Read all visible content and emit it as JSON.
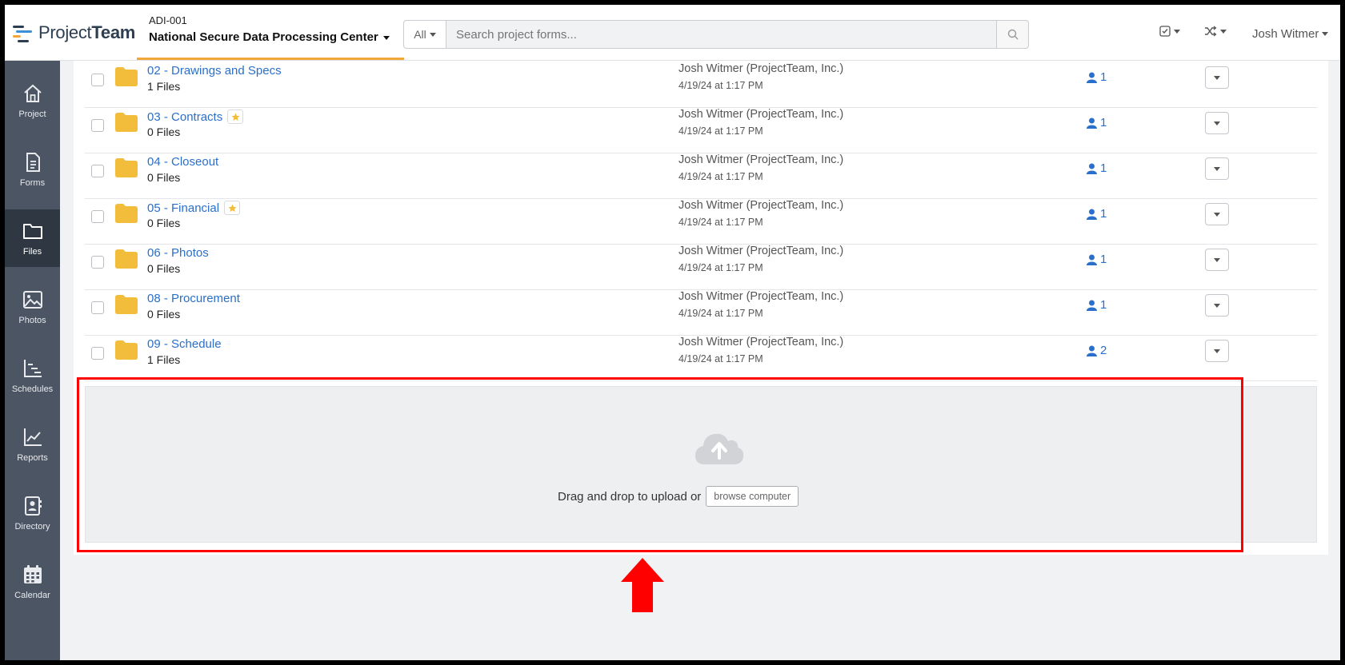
{
  "header": {
    "logo_prefix": "Project",
    "logo_suffix": "Team",
    "project_code": "ADI-001",
    "project_name": "National Secure Data Processing Center",
    "search_scope": "All",
    "search_placeholder": "Search project forms...",
    "user_name": "Josh Witmer",
    "icons": [
      "checklist-icon",
      "shuffle-icon",
      "search-icon"
    ]
  },
  "sidebar": {
    "items": [
      {
        "label": "Project",
        "icon": "home-icon",
        "active": false
      },
      {
        "label": "Forms",
        "icon": "document-icon",
        "active": false
      },
      {
        "label": "Files",
        "icon": "folder-icon",
        "active": true
      },
      {
        "label": "Photos",
        "icon": "image-icon",
        "active": false
      },
      {
        "label": "Schedules",
        "icon": "gantt-icon",
        "active": false
      },
      {
        "label": "Reports",
        "icon": "chart-icon",
        "active": false
      },
      {
        "label": "Directory",
        "icon": "contact-card-icon",
        "active": false
      },
      {
        "label": "Calendar",
        "icon": "calendar-icon",
        "active": false
      }
    ]
  },
  "folders": [
    {
      "name": "02 - Drawings and Specs",
      "count": "1 Files",
      "starred": false,
      "owner": "Josh Witmer (ProjectTeam, Inc.)",
      "date": "4/19/24 at 1:17 PM",
      "members": "1"
    },
    {
      "name": "03 - Contracts",
      "count": "0 Files",
      "starred": true,
      "owner": "Josh Witmer (ProjectTeam, Inc.)",
      "date": "4/19/24 at 1:17 PM",
      "members": "1"
    },
    {
      "name": "04 - Closeout",
      "count": "0 Files",
      "starred": false,
      "owner": "Josh Witmer (ProjectTeam, Inc.)",
      "date": "4/19/24 at 1:17 PM",
      "members": "1"
    },
    {
      "name": "05 - Financial",
      "count": "0 Files",
      "starred": true,
      "owner": "Josh Witmer (ProjectTeam, Inc.)",
      "date": "4/19/24 at 1:17 PM",
      "members": "1"
    },
    {
      "name": "06 - Photos",
      "count": "0 Files",
      "starred": false,
      "owner": "Josh Witmer (ProjectTeam, Inc.)",
      "date": "4/19/24 at 1:17 PM",
      "members": "1"
    },
    {
      "name": "08 - Procurement",
      "count": "0 Files",
      "starred": false,
      "owner": "Josh Witmer (ProjectTeam, Inc.)",
      "date": "4/19/24 at 1:17 PM",
      "members": "1"
    },
    {
      "name": "09 - Schedule",
      "count": "1 Files",
      "starred": false,
      "owner": "Josh Witmer (ProjectTeam, Inc.)",
      "date": "4/19/24 at 1:17 PM",
      "members": "2"
    }
  ],
  "dropzone": {
    "text": "Drag and drop to upload or",
    "browse_label": "browse computer"
  },
  "colors": {
    "accent": "#f3a73b",
    "link": "#2a6fc9",
    "sidebar": "#4b5563",
    "highlight": "#ff0000"
  }
}
